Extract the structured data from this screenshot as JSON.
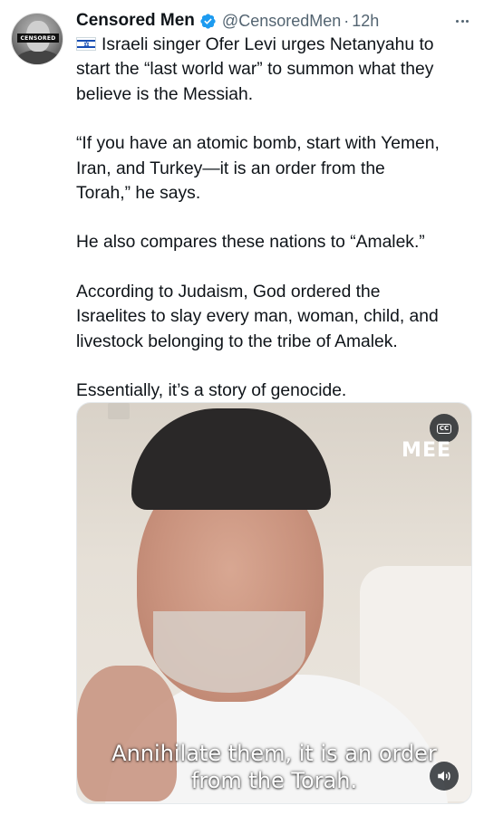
{
  "author": {
    "name": "Censored Men",
    "handle": "@CensoredMen",
    "separator": "·",
    "time": "12h",
    "avatar_label": "CENSORED",
    "verified_color": "#1d9bf0"
  },
  "icons": {
    "verified": "verified-badge-icon",
    "more": "more-dots-icon",
    "flag": "israel-flag-icon",
    "captions": "closed-captions-icon",
    "volume": "volume-icon"
  },
  "tweet": {
    "paragraphs": [
      "Israeli singer Ofer Levi urges Netanyahu to\nstart the “last world war” to summon what they\nbelieve is the Messiah.",
      "“If you have an atomic bomb, start with Yemen,\nIran, and Turkey—it is an order from the\nTorah,” he says.",
      "He also compares these nations to “Amalek.”",
      "According to Judaism, God ordered the\nIsraelites to slay every man, woman, child, and\nlivestock belonging to the tribe of Amalek.",
      "Essentially, it’s a story of genocide."
    ]
  },
  "media": {
    "logo": "MEE",
    "cc_label": "CC",
    "caption_line1": "Annihilate them, it is an order",
    "caption_line2": "from the Torah."
  }
}
